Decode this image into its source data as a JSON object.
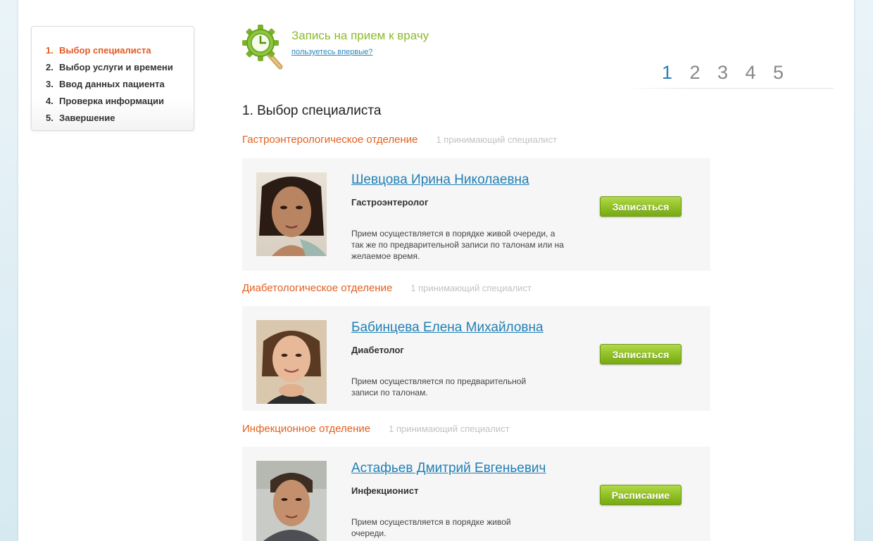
{
  "steps": [
    {
      "num": "1.",
      "label": "Выбор специалиста",
      "active": true
    },
    {
      "num": "2.",
      "label": "Выбор услуги и времени",
      "active": false
    },
    {
      "num": "3.",
      "label": "Ввод данных пациента",
      "active": false
    },
    {
      "num": "4.",
      "label": "Проверка информации",
      "active": false
    },
    {
      "num": "5.",
      "label": "Завершение",
      "active": false
    }
  ],
  "header": {
    "title": "Запись на прием к врачу",
    "first_time_link": "пользуетесь впервые?"
  },
  "pager": {
    "pages": [
      "1",
      "2",
      "3",
      "4",
      "5"
    ],
    "current": "1"
  },
  "section_title": "1. Выбор специалиста",
  "departments": [
    {
      "name": "Гастроэнтерологическое отделение",
      "count": "1 принимающий специалист",
      "doctor": {
        "name": "Шевцова Ирина Николаевна",
        "specialty": "Гастроэнтеролог",
        "note": "Прием осуществляется в порядке живой очереди, а так же по предварительной записи по талонам или на желаемое время.",
        "button": "Записаться"
      }
    },
    {
      "name": "Диабетологическое отделение",
      "count": "1 принимающий специалист",
      "doctor": {
        "name": "Бабинцева Елена Михайловна",
        "specialty": "Диабетолог",
        "note": "Прием осуществляется по предварительной записи по талонам.",
        "button": "Записаться"
      }
    },
    {
      "name": "Инфекционное отделение",
      "count": "1 принимающий специалист",
      "doctor": {
        "name": "Астафьев Дмитрий Евгеньевич",
        "specialty": "Инфекционист",
        "note": "Прием осуществляется в порядке живой очереди.",
        "button": "Расписание"
      }
    }
  ],
  "colors": {
    "accent_orange": "#e25a24",
    "title_green": "#8cbb2c",
    "link_blue": "#2180b5",
    "button_green": "#8ebf24"
  },
  "icons": {
    "logo": "clock-magnifier-icon"
  }
}
